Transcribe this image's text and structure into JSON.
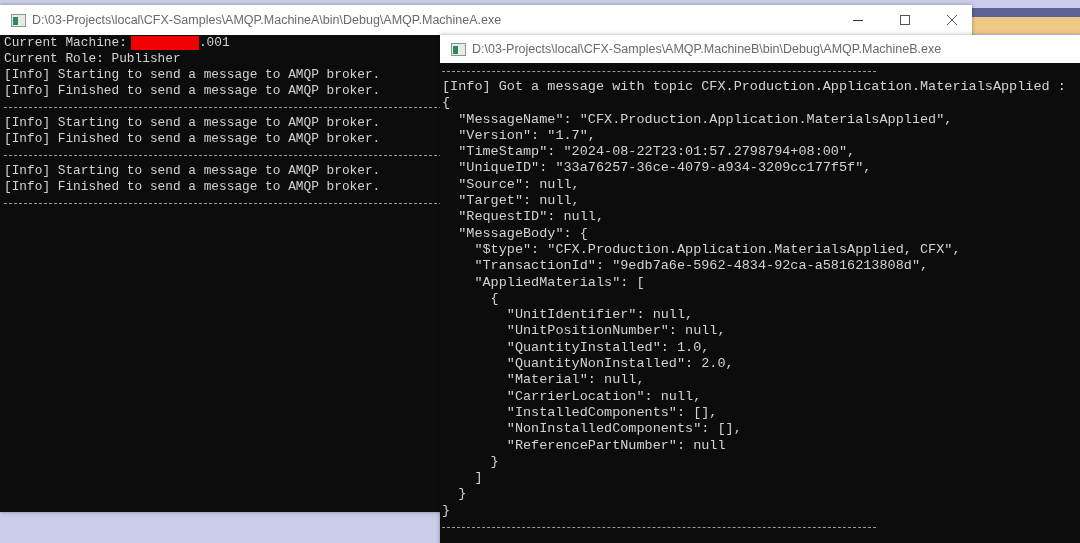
{
  "windows": [
    {
      "title": "D:\\03-Projects\\local\\CFX-Samples\\AMQP.MachineA\\bin\\Debug\\AMQP.MachineA.exe",
      "controls": true,
      "console": [
        {
          "kind": "redacted",
          "before": "Current Machine:",
          "after": ".001"
        },
        {
          "kind": "line",
          "text": "Current Role: Publisher"
        },
        {
          "kind": "line",
          "text": "[Info] Starting to send a message to AMQP broker."
        },
        {
          "kind": "line",
          "text": "[Info] Finished to send a message to AMQP broker."
        },
        {
          "kind": "separator"
        },
        {
          "kind": "line",
          "text": "[Info] Starting to send a message to AMQP broker."
        },
        {
          "kind": "line",
          "text": "[Info] Finished to send a message to AMQP broker."
        },
        {
          "kind": "separator"
        },
        {
          "kind": "line",
          "text": "[Info] Starting to send a message to AMQP broker."
        },
        {
          "kind": "line",
          "text": "[Info] Finished to send a message to AMQP broker."
        },
        {
          "kind": "separator"
        }
      ]
    },
    {
      "title": "D:\\03-Projects\\local\\CFX-Samples\\AMQP.MachineB\\bin\\Debug\\AMQP.MachineB.exe",
      "controls": false,
      "console": [
        {
          "kind": "separator"
        },
        {
          "kind": "line",
          "text": "[Info] Got a message with topic CFX.Production.Application.MaterialsApplied :"
        },
        {
          "kind": "line",
          "text": "{"
        },
        {
          "kind": "line",
          "text": "  \"MessageName\": \"CFX.Production.Application.MaterialsApplied\","
        },
        {
          "kind": "line",
          "text": "  \"Version\": \"1.7\","
        },
        {
          "kind": "line",
          "text": "  \"TimeStamp\": \"2024-08-22T23:01:57.2798794+08:00\","
        },
        {
          "kind": "line",
          "text": "  \"UniqueID\": \"33a76257-36ce-4079-a934-3209cc177f5f\","
        },
        {
          "kind": "line",
          "text": "  \"Source\": null,"
        },
        {
          "kind": "line",
          "text": "  \"Target\": null,"
        },
        {
          "kind": "line",
          "text": "  \"RequestID\": null,"
        },
        {
          "kind": "line",
          "text": "  \"MessageBody\": {"
        },
        {
          "kind": "line",
          "text": "    \"$type\": \"CFX.Production.Application.MaterialsApplied, CFX\","
        },
        {
          "kind": "line",
          "text": "    \"TransactionId\": \"9edb7a6e-5962-4834-92ca-a5816213808d\","
        },
        {
          "kind": "line",
          "text": "    \"AppliedMaterials\": ["
        },
        {
          "kind": "line",
          "text": "      {"
        },
        {
          "kind": "line",
          "text": "        \"UnitIdentifier\": null,"
        },
        {
          "kind": "line",
          "text": "        \"UnitPositionNumber\": null,"
        },
        {
          "kind": "line",
          "text": "        \"QuantityInstalled\": 1.0,"
        },
        {
          "kind": "line",
          "text": "        \"QuantityNonInstalled\": 2.0,"
        },
        {
          "kind": "line",
          "text": "        \"Material\": null,"
        },
        {
          "kind": "line",
          "text": "        \"CarrierLocation\": null,"
        },
        {
          "kind": "line",
          "text": "        \"InstalledComponents\": [],"
        },
        {
          "kind": "line",
          "text": "        \"NonInstalledComponents\": [],"
        },
        {
          "kind": "line",
          "text": "        \"ReferencePartNumber\": null"
        },
        {
          "kind": "line",
          "text": "      }"
        },
        {
          "kind": "line",
          "text": "    ]"
        },
        {
          "kind": "line",
          "text": "  }"
        },
        {
          "kind": "line",
          "text": "}"
        },
        {
          "kind": "separator"
        }
      ]
    }
  ]
}
